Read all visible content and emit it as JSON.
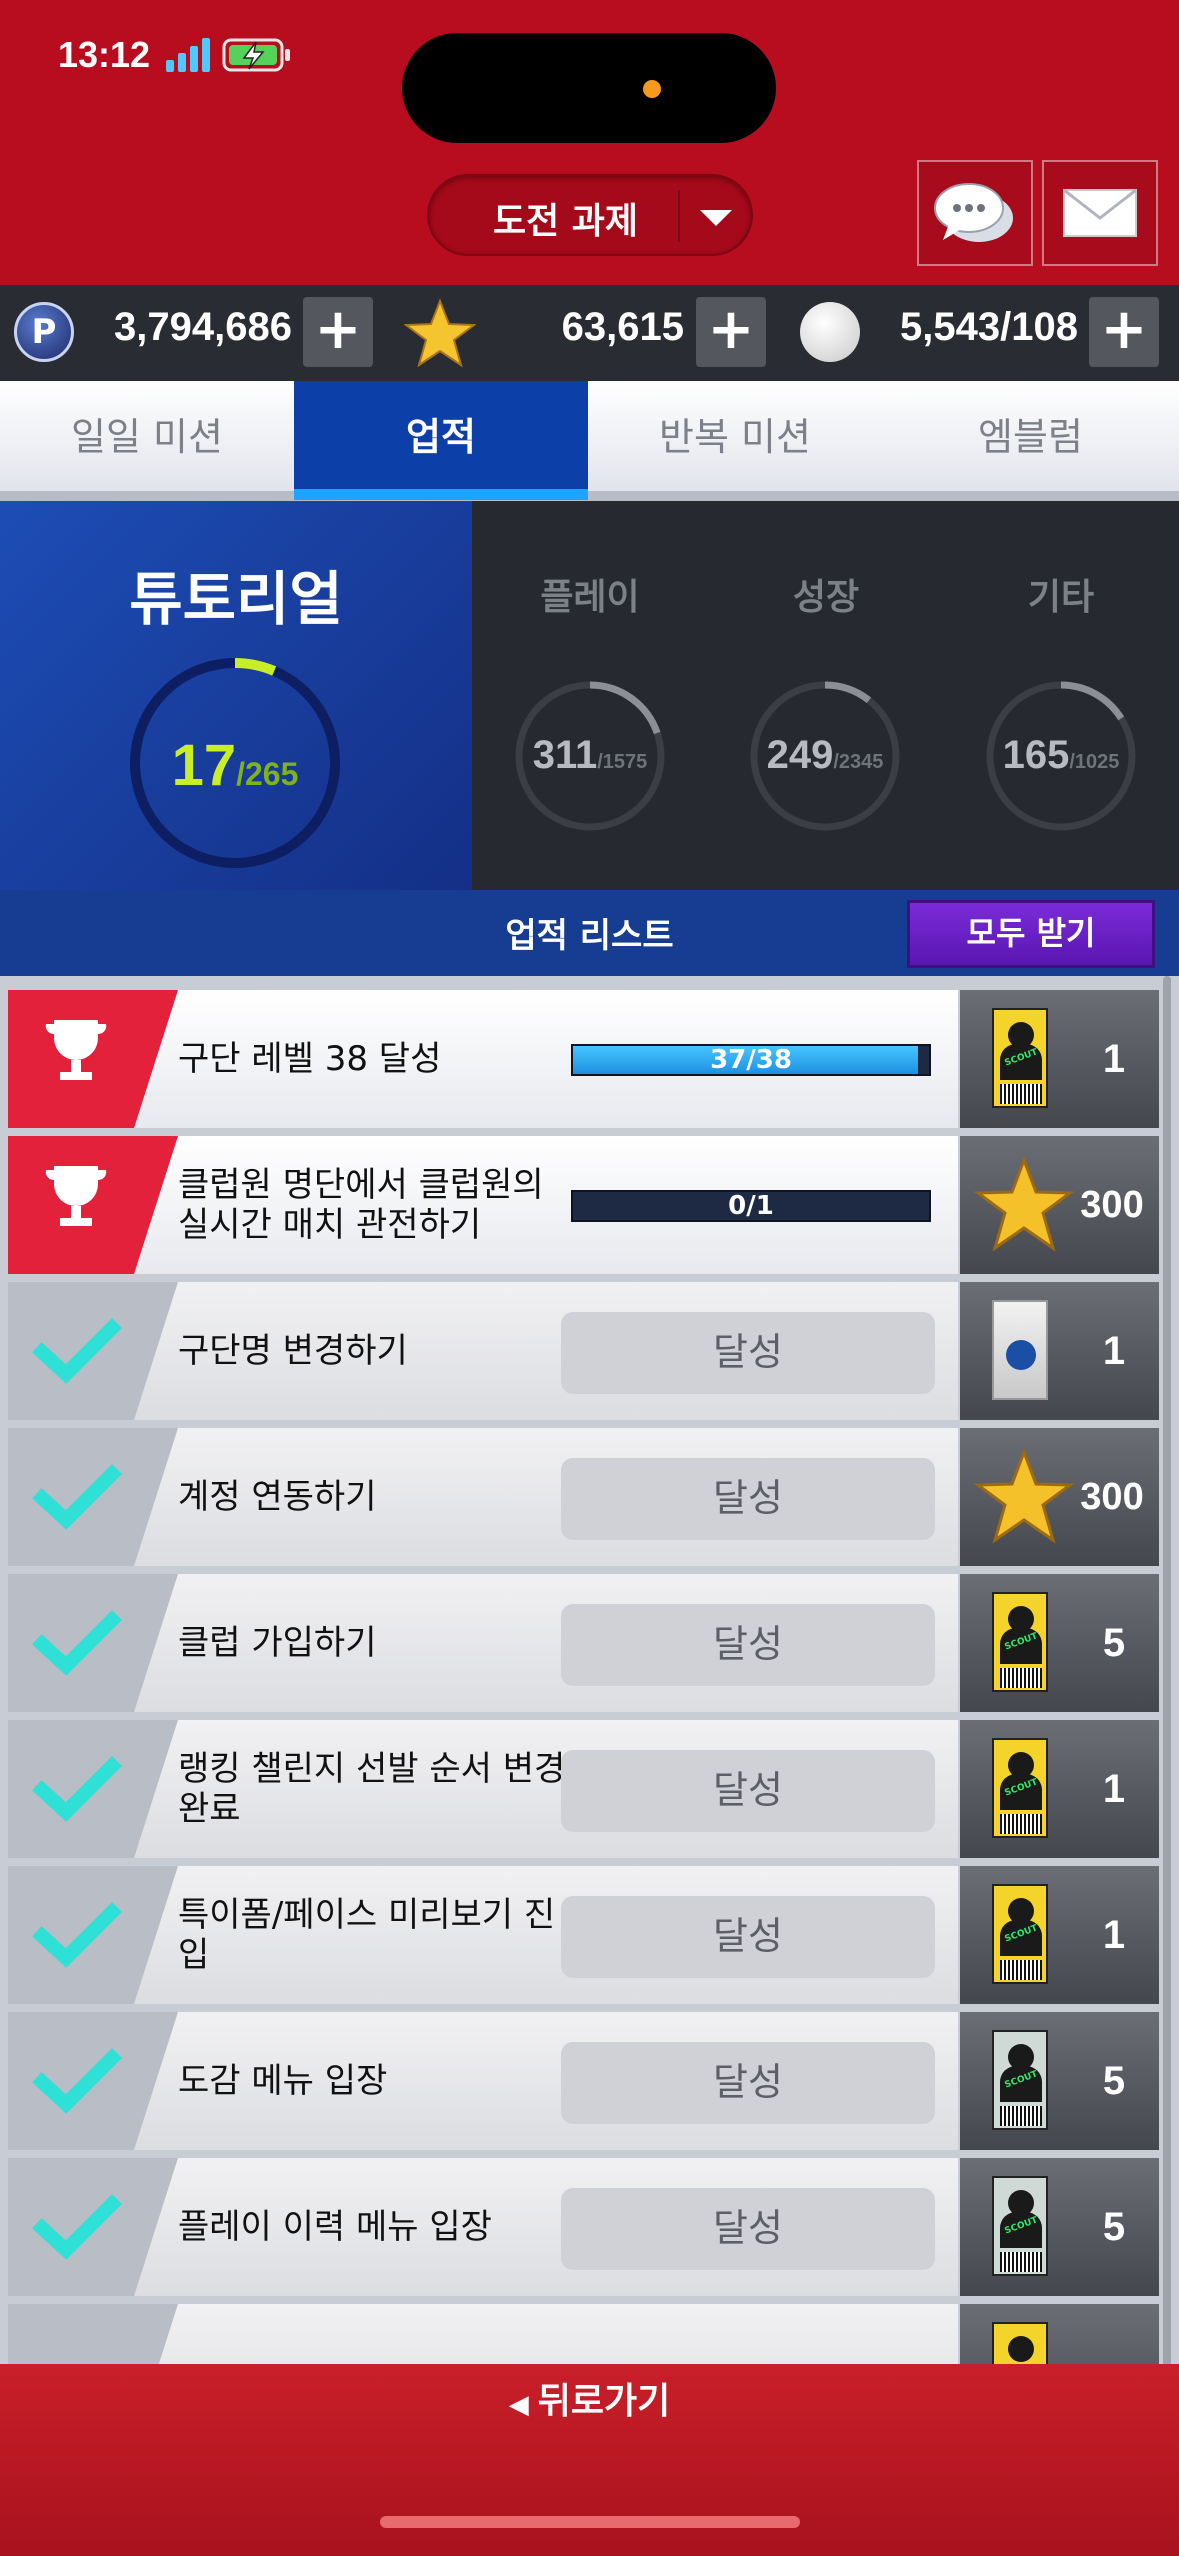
{
  "status_bar": {
    "time": "13:12"
  },
  "header": {
    "mission_label": "도전 과제"
  },
  "currency": {
    "points": "3,794,686",
    "stars": "63,615",
    "balls": "5,543/108"
  },
  "tabs": [
    {
      "label": "일일 미션",
      "active": false
    },
    {
      "label": "업적",
      "active": true
    },
    {
      "label": "반복 미션",
      "active": false
    },
    {
      "label": "엠블럼",
      "active": false
    }
  ],
  "summary": {
    "main": {
      "title": "튜토리얼",
      "value": "17",
      "total": "/265"
    },
    "categories": [
      {
        "label": "플레이",
        "value": "311",
        "total": "/1575"
      },
      {
        "label": "성장",
        "value": "249",
        "total": "/2345"
      },
      {
        "label": "기타",
        "value": "165",
        "total": "/1025"
      }
    ]
  },
  "list": {
    "title": "업적 리스트",
    "claim_all": "모두 받기",
    "done_label": "달성"
  },
  "achievements": [
    {
      "title": "구단 레벨 38 달성",
      "status": "in_progress",
      "progress": "37/38",
      "progress_fraction": 0.97,
      "reward_icon": "scout-ticket",
      "reward_count": "1"
    },
    {
      "title": "클럽원 명단에서 클럽원의 실시간 매치 관전하기",
      "status": "in_progress",
      "progress": "0/1",
      "progress_fraction": 0,
      "reward_icon": "star",
      "reward_count": "300"
    },
    {
      "title": "구단명 변경하기",
      "status": "done",
      "reward_icon": "player-pack",
      "reward_count": "1"
    },
    {
      "title": "계정 연동하기",
      "status": "done",
      "reward_icon": "star",
      "reward_count": "300"
    },
    {
      "title": "클럽 가입하기",
      "status": "done",
      "reward_icon": "scout-ticket",
      "reward_count": "5"
    },
    {
      "title": "랭킹 챌린지 선발 순서 변경 완료",
      "status": "done",
      "reward_icon": "scout-ticket",
      "reward_count": "1"
    },
    {
      "title": "특이폼/페이스 미리보기 진입",
      "status": "done",
      "reward_icon": "scout-ticket",
      "reward_count": "1"
    },
    {
      "title": "도감 메뉴 입장",
      "status": "done",
      "reward_icon": "scout-ticket-silver",
      "reward_count": "5"
    },
    {
      "title": "플레이 이력 메뉴 입장",
      "status": "done",
      "reward_icon": "scout-ticket-silver",
      "reward_count": "5"
    }
  ],
  "footer": {
    "back_label": "뒤로가기"
  },
  "colors": {
    "header_red": "#b80d1f",
    "tab_active": "#0d3fa8",
    "accent_cyan": "#1ca4ff",
    "progress_ring": "#c8ee2a"
  }
}
